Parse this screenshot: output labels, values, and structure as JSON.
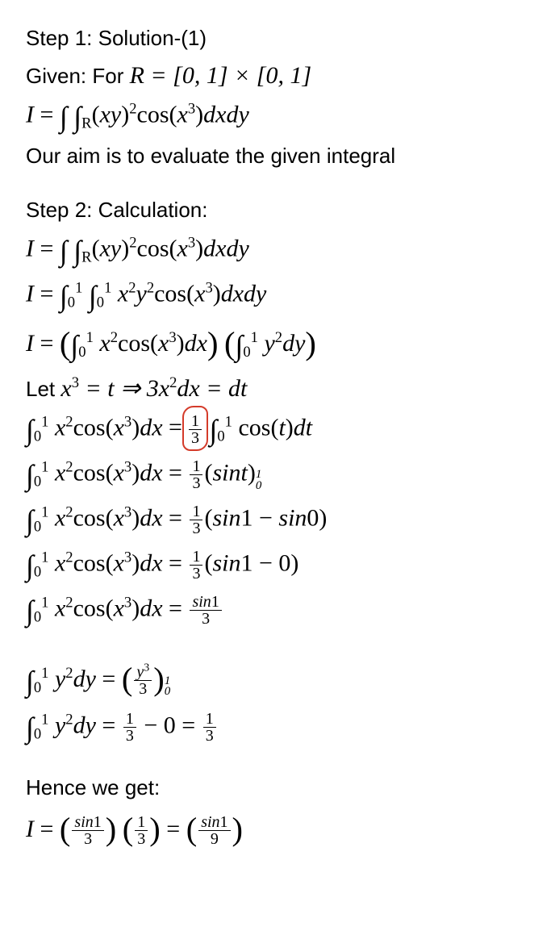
{
  "step1": {
    "heading": "Step 1: Solution-(1)",
    "given_prefix": "Given: For ",
    "given_math": "R = [0, 1] × [0, 1]",
    "I_line": "I = ∫ ∫_R (xy)² cos(x³) dxdy",
    "aim": "Our aim is to evaluate the given integral"
  },
  "step2": {
    "heading": "Step 2: Calculation:",
    "lines": {
      "l1": "I = ∫ ∫_R (xy)² cos(x³) dxdy",
      "l2": "I = ∫₀¹ ∫₀¹ x² y² cos(x³) dxdy",
      "l3": "I = (∫₀¹ x² cos(x³) dx)(∫₀¹ y² dy)",
      "let_prefix": "Let ",
      "let_math": "x³ = t ⇒ 3x² dx = dt",
      "l4_lhs": "∫₀¹ x² cos(x³) dx",
      "l4_rhs": "(1/3) ∫₀¹ cos(t) dt",
      "l5": "∫₀¹ x² cos(x³) dx = (1/3)(sin t)₀¹",
      "l6": "∫₀¹ x² cos(x³) dx = (1/3)(sin1 − sin0)",
      "l7": "∫₀¹ x² cos(x³) dx = (1/3)(sin1 − 0)",
      "l8": "∫₀¹ x² cos(x³) dx = sin1 / 3",
      "l9": "∫₀¹ y² dy = (y³/3)₀¹",
      "l10": "∫₀¹ y² dy = 1/3 − 0 = 1/3"
    }
  },
  "hence": {
    "heading": "Hence we get:",
    "line": "I = (sin1/3)(1/3) = (sin1/9)"
  },
  "chart_data": {
    "type": "table",
    "note": "mathematical derivation, no chart values"
  }
}
